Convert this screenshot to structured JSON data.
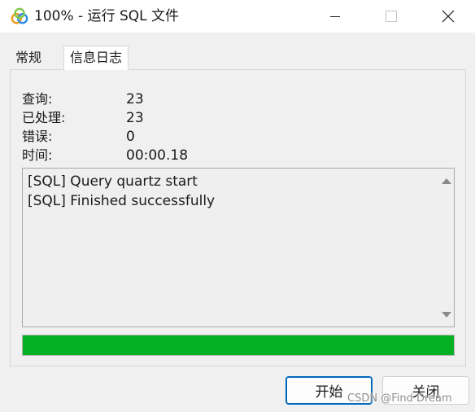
{
  "window": {
    "title": "100% - 运行 SQL 文件",
    "icons": {
      "app": "navicat-icon",
      "minimize": "minimize-icon",
      "maximize": "maximize-icon",
      "close": "close-icon"
    }
  },
  "tabs": [
    {
      "label": "常规",
      "active": false
    },
    {
      "label": "信息日志",
      "active": true
    }
  ],
  "stats": [
    {
      "label": "查询:",
      "value": "23"
    },
    {
      "label": "已处理:",
      "value": "23"
    },
    {
      "label": "错误:",
      "value": "0"
    },
    {
      "label": "时间:",
      "value": "00:00.18"
    }
  ],
  "log": {
    "lines": [
      "[SQL] Query quartz start",
      "[SQL] Finished successfully"
    ]
  },
  "progress": {
    "percent": 100,
    "color": "#06b025"
  },
  "buttons": {
    "start": "开始",
    "close": "关闭"
  },
  "watermark": "CSDN @Find Dream"
}
